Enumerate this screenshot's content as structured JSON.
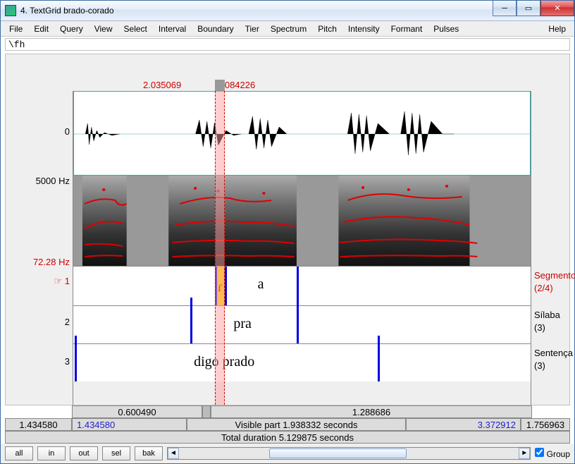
{
  "window": {
    "title": "4. TextGrid brado-corado"
  },
  "menus": {
    "file": "File",
    "edit": "Edit",
    "query": "Query",
    "view": "View",
    "select": "Select",
    "interval": "Interval",
    "boundary": "Boundary",
    "tier": "Tier",
    "spectrum": "Spectrum",
    "pitch": "Pitch",
    "intensity": "Intensity",
    "formant": "Formant",
    "pulses": "Pulses",
    "help": "Help"
  },
  "formula": "\\fh",
  "selection": {
    "left": "2.035069",
    "right": "2.084226"
  },
  "axes": {
    "wave_zero": "0",
    "spec_top": "5000 Hz",
    "spec_bottom": "72.28 Hz",
    "tier1_ptr": "☞ 1",
    "tier2_num": "2",
    "tier3_num": "3"
  },
  "tiers": {
    "t1": {
      "name": "Segmento",
      "count": "(2/4)",
      "seg1": "ɾ",
      "seg2": "a"
    },
    "t2": {
      "name": "Sílaba",
      "count": "(3)",
      "seg": "pra"
    },
    "t3": {
      "name": "Sentença",
      "count": "(3)",
      "seg": "digo prado"
    }
  },
  "scroll": {
    "pre": "1.434580",
    "start": "1.434580",
    "vis_left": "0.600490",
    "vis_right": "1.288686",
    "end": "3.372912",
    "post": "1.756963",
    "visible": "Visible part 1.938332 seconds",
    "total": "Total duration 5.129875 seconds"
  },
  "buttons": {
    "all": "all",
    "in": "in",
    "out": "out",
    "sel": "sel",
    "bak": "bak"
  },
  "group": "Group"
}
